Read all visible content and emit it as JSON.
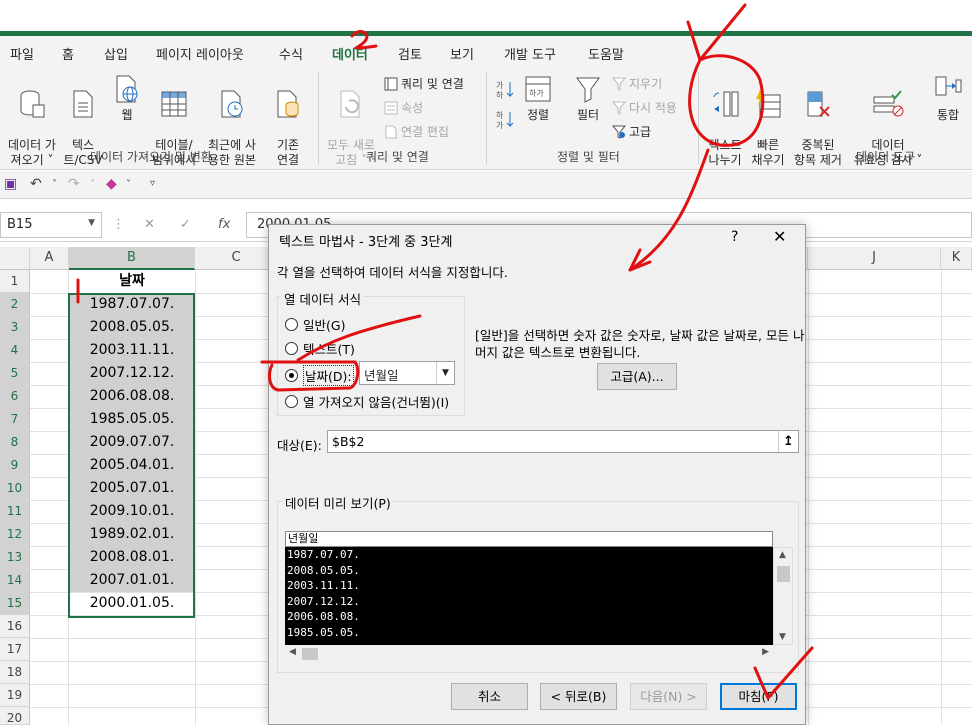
{
  "tabs": [
    "파일",
    "홈",
    "삽입",
    "페이지 레이아웃",
    "수식",
    "데이터",
    "검토",
    "보기",
    "개발 도구",
    "도움말"
  ],
  "active_tab": "데이터",
  "ribbon": {
    "get_data": "데이터 가\n져오기 ˅",
    "text_csv": "텍스\n트/CSV",
    "web": "웹",
    "from_table": "테이블/\n범위에서",
    "recent_sources": "최근에 사\n용한 원본",
    "existing_conn": "기존\n연결",
    "group_get": "데이터 가져오기 및 변환",
    "refresh_all": "모두 새로\n고침 ˅",
    "queries_conn": "쿼리 및 연결",
    "properties": "속성",
    "edit_links": "연결 편집",
    "group_queries": "쿼리 및 연결",
    "sort": "정렬",
    "filter": "필터",
    "clear": "지우기",
    "reapply": "다시 적용",
    "advanced": "고급",
    "group_sort": "정렬 및 필터",
    "text_to_columns": "텍스트\n나누기",
    "flash_fill": "빠른\n채우기",
    "remove_dup": "중복된\n항목 제거",
    "data_validation": "데이터\n유효성 검사 ˅",
    "consolidate": "통합",
    "group_tools": "데이터 도구"
  },
  "namebox": "B15",
  "formula": "2000.01.05.",
  "fx": "fx",
  "columns": [
    "A",
    "B",
    "C",
    "D",
    "E",
    "F",
    "G",
    "H",
    "I",
    "J",
    "K"
  ],
  "rows": [
    "1",
    "2",
    "3",
    "4",
    "5",
    "6",
    "7",
    "8",
    "9",
    "10",
    "11",
    "12",
    "13",
    "14",
    "15",
    "16",
    "17",
    "18",
    "19",
    "20"
  ],
  "cells_b": [
    "날짜",
    "1987.07.07.",
    "2008.05.05.",
    "2003.11.11.",
    "2007.12.12.",
    "2006.08.08.",
    "1985.05.05.",
    "2009.07.07.",
    "2005.04.01.",
    "2005.07.01.",
    "2009.10.01.",
    "1989.02.01.",
    "2008.08.01.",
    "2007.01.01.",
    "2000.01.05."
  ],
  "dialog": {
    "title": "텍스트 마법사 - 3단계 중 3단계",
    "help": "?",
    "close": "✕",
    "desc": "각 열을 선택하여 데이터 서식을 지정합니다.",
    "fmt_legend": "열 데이터 서식",
    "radio_general": "일반(G)",
    "radio_text": "텍스트(T)",
    "radio_date": "날짜(D):",
    "date_format": "년월일",
    "radio_skip": "열 가져오지 않음(건너뜀)(I)",
    "help_text": "[일반]을 선택하면 숫자 값은 숫자로, 날짜 값은 날짜로, 모든 나머지 값은 텍스트로 변환됩니다.",
    "advanced_btn": "고급(A)...",
    "target_label": "대상(E):",
    "target_value": "$B$2",
    "preview_label": "데이터 미리 보기(P)",
    "preview_header": "년월일",
    "preview_rows": [
      "1987.07.07.",
      "2008.05.05.",
      "2003.11.11.",
      "2007.12.12.",
      "2006.08.08.",
      "1985.05.05."
    ],
    "btn_cancel": "취소",
    "btn_back": "< 뒤로(B)",
    "btn_next": "다음(N) >",
    "btn_finish": "마침(F)"
  },
  "annotations": {
    "step_number": "2",
    "color": "#e01010"
  },
  "colors": {
    "excel_green": "#217346",
    "ribbon_bg": "#f3f3f3",
    "selected_fill": "#d0d0d0"
  }
}
